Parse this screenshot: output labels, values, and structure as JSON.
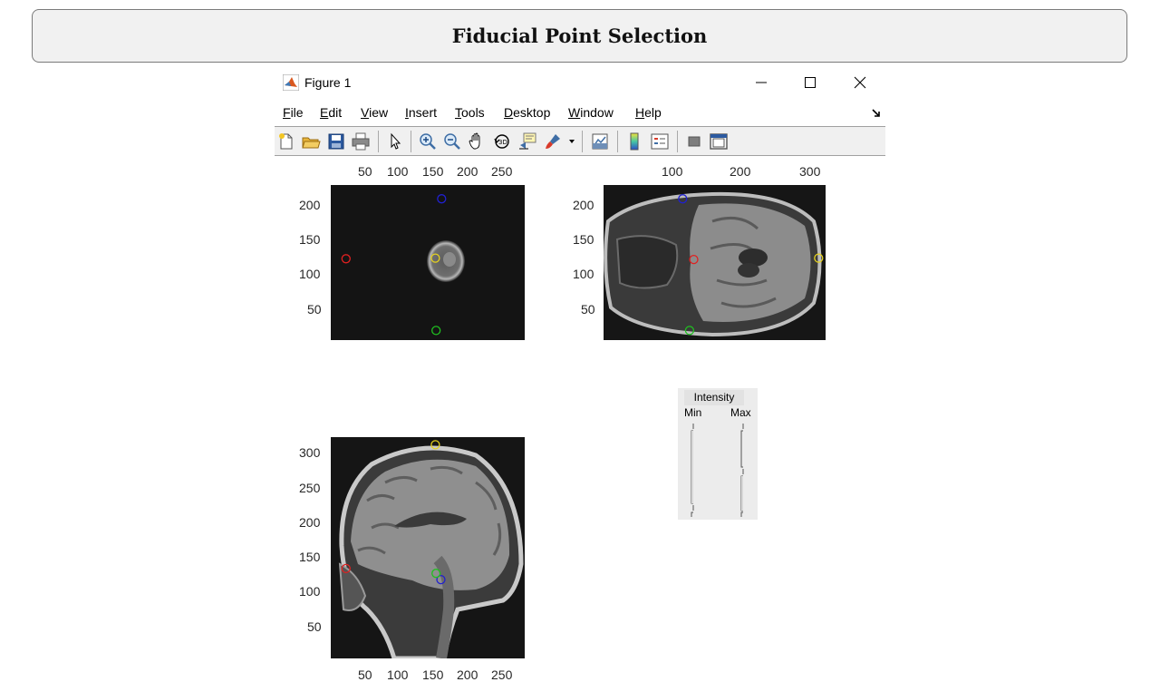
{
  "banner": {
    "title": "Fiducial Point Selection"
  },
  "window": {
    "title": "Figure 1",
    "menu": [
      {
        "mnemonic": "F",
        "rest": "ile"
      },
      {
        "mnemonic": "E",
        "rest": "dit"
      },
      {
        "mnemonic": "V",
        "rest": "iew"
      },
      {
        "mnemonic": "I",
        "rest": "nsert"
      },
      {
        "mnemonic": "T",
        "rest": "ools"
      },
      {
        "mnemonic": "D",
        "rest": "esktop"
      },
      {
        "mnemonic": "W",
        "rest": "indow"
      },
      {
        "mnemonic": "H",
        "rest": "elp"
      }
    ],
    "toolbar_icons": [
      "new-figure-icon",
      "open-file-icon",
      "save-icon",
      "print-icon",
      "pointer-icon",
      "zoom-in-icon",
      "zoom-out-icon",
      "pan-icon",
      "rotate-3d-icon",
      "data-cursor-icon",
      "brush-icon",
      "dropdown-arrow-icon",
      "link-plot-icon",
      "colorbar-icon",
      "legend-icon",
      "hide-plot-tools-icon",
      "show-plot-tools-icon"
    ]
  },
  "axes": {
    "axial": {
      "x_ticks": [
        "50",
        "100",
        "150",
        "200",
        "250"
      ],
      "y_ticks": [
        "200",
        "150",
        "100",
        "50"
      ],
      "x_range": [
        0,
        280
      ],
      "y_range": [
        0,
        225
      ],
      "points": [
        {
          "label": "red",
          "color": "#e02020",
          "x": 22,
          "y": 118
        },
        {
          "label": "yellow",
          "color": "#e6d21e",
          "x": 151,
          "y": 119
        },
        {
          "label": "blue",
          "color": "#2020d0",
          "x": 160,
          "y": 205
        },
        {
          "label": "green",
          "color": "#20c020",
          "x": 152,
          "y": 14
        }
      ]
    },
    "coronal": {
      "x_ticks": [
        "100",
        "200",
        "300"
      ],
      "y_ticks": [
        "200",
        "150",
        "100",
        "50"
      ],
      "x_range": [
        0,
        320
      ],
      "y_range": [
        0,
        225
      ],
      "points": [
        {
          "label": "red",
          "color": "#e02020",
          "x": 130,
          "y": 117
        },
        {
          "label": "yellow",
          "color": "#e6d21e",
          "x": 310,
          "y": 119
        },
        {
          "label": "blue",
          "color": "#2020d0",
          "x": 114,
          "y": 205
        },
        {
          "label": "green",
          "color": "#20c020",
          "x": 124,
          "y": 14
        }
      ]
    },
    "sagittal": {
      "x_ticks": [
        "50",
        "100",
        "150",
        "200",
        "250"
      ],
      "y_ticks": [
        "300",
        "250",
        "200",
        "150",
        "100",
        "50"
      ],
      "x_range": [
        0,
        280
      ],
      "y_range": [
        0,
        320
      ],
      "points": [
        {
          "label": "red",
          "color": "#e02020",
          "x": 22,
          "y": 130
        },
        {
          "label": "yellow",
          "color": "#e6d21e",
          "x": 151,
          "y": 309
        },
        {
          "label": "blue",
          "color": "#2020d0",
          "x": 159,
          "y": 114
        },
        {
          "label": "green",
          "color": "#20c020",
          "x": 152,
          "y": 123
        }
      ]
    }
  },
  "intensity": {
    "title": "Intensity",
    "min_label": "Min",
    "max_label": "Max"
  }
}
